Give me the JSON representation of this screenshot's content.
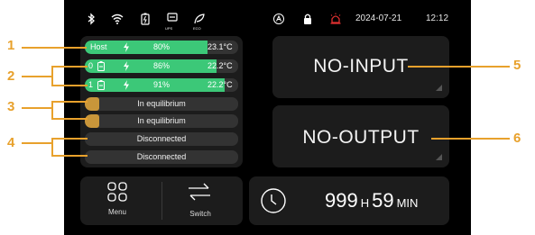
{
  "status_bar": {
    "icons": [
      "bluetooth-icon",
      "wifi-icon",
      "battery-icon",
      "ups-icon",
      "eco-icon",
      "auto-icon",
      "lock-icon",
      "alarm-icon"
    ],
    "ups_label": "UPS",
    "eco_label": "ECO",
    "date": "2024-07-21",
    "time": "12:12"
  },
  "batteries": [
    {
      "label": "Host",
      "percent": "80%",
      "temp": "23.1°C",
      "fill": 0.8,
      "status": "charging"
    },
    {
      "label": "0",
      "percent": "86%",
      "temp": "22.2°C",
      "fill": 0.86,
      "status": "charging"
    },
    {
      "label": "1",
      "percent": "91%",
      "temp": "22.2°C",
      "fill": 0.91,
      "status": "charging"
    }
  ],
  "equilibrium": [
    {
      "text": "In equilibrium"
    },
    {
      "text": "In equilibrium"
    }
  ],
  "disconnected": [
    {
      "text": "Disconnected"
    },
    {
      "text": "Disconnected"
    }
  ],
  "input_card": {
    "text": "NO-INPUT"
  },
  "output_card": {
    "text": "NO-OUTPUT"
  },
  "menu": {
    "label": "Menu"
  },
  "switch": {
    "label": "Switch"
  },
  "timer": {
    "hours": "999",
    "hours_unit": "H",
    "minutes": "59",
    "minutes_unit": "MIN"
  },
  "annotations": [
    "1",
    "2",
    "3",
    "4",
    "5",
    "6"
  ],
  "colors": {
    "accent": "#e8a12c",
    "bar": "#3cc878",
    "equilibrium": "#c9963a",
    "alarm": "#e03030"
  }
}
